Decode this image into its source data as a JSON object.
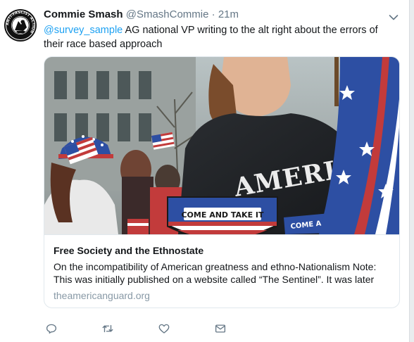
{
  "tweet": {
    "display_name": "Commie Smash",
    "handle": "@SmashCommie",
    "separator": "·",
    "time": "21m",
    "mention": "@survey_sample",
    "text": " AG national VP writing to the alt right about the errors of their race based approach"
  },
  "avatar": {
    "ring_text": "ANTI-FASCIST ACTION"
  },
  "card": {
    "title": "Free Society and the Ethnostate",
    "description": "On the incompatibility of American greatness and ethno-Nationalism Note: This was initially published on a website called “The Sentinel”. It was later",
    "domain": "theamericanguard.org",
    "image": {
      "shirt_text": "AMERICAN",
      "patch_text": "COME AND TAKE IT",
      "patch_text_2": "COME A"
    }
  },
  "actions": {
    "reply_icon": "reply-icon",
    "retweet_icon": "retweet-icon",
    "like_icon": "heart-icon",
    "dm_icon": "envelope-icon"
  },
  "colors": {
    "link": "#1da1f2",
    "muted": "#657786",
    "domain": "#8899a6",
    "border": "#e1e8ed"
  }
}
